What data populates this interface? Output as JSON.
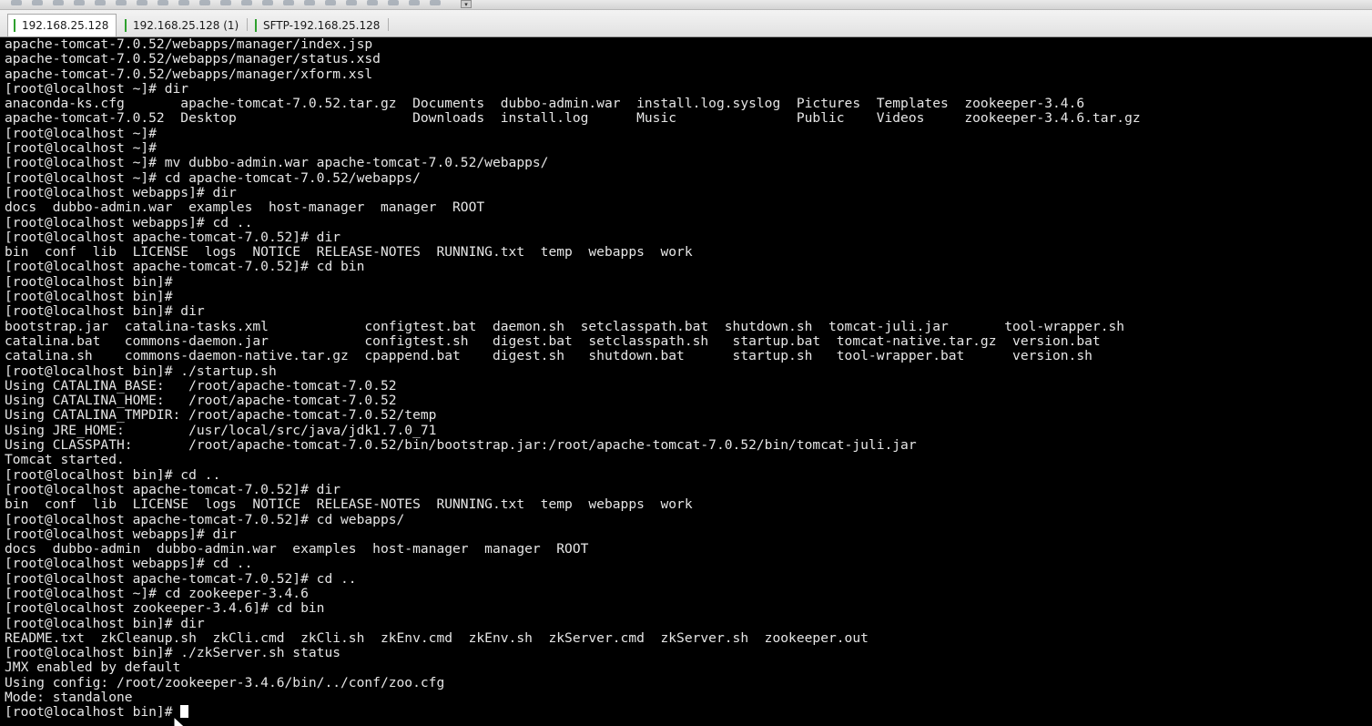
{
  "toolbar": {
    "icons": [
      "toolbar-icon",
      "toolbar-icon",
      "toolbar-icon",
      "toolbar-icon",
      "toolbar-icon",
      "toolbar-icon",
      "toolbar-icon",
      "toolbar-icon",
      "toolbar-icon",
      "toolbar-icon",
      "toolbar-icon",
      "toolbar-icon",
      "toolbar-icon",
      "toolbar-icon",
      "toolbar-icon",
      "toolbar-icon",
      "toolbar-icon",
      "toolbar-icon",
      "toolbar-icon",
      "toolbar-icon",
      "toolbar-icon"
    ],
    "dropdown_glyph": "▾"
  },
  "tabs": [
    {
      "label": "192.168.25.128",
      "active": true
    },
    {
      "label": "192.168.25.128 (1)",
      "active": false
    },
    {
      "label": "SFTP-192.168.25.128",
      "active": false
    }
  ],
  "terminal": {
    "lines": [
      "apache-tomcat-7.0.52/webapps/manager/index.jsp",
      "apache-tomcat-7.0.52/webapps/manager/status.xsd",
      "apache-tomcat-7.0.52/webapps/manager/xform.xsl",
      "[root@localhost ~]# dir",
      "anaconda-ks.cfg       apache-tomcat-7.0.52.tar.gz  Documents  dubbo-admin.war  install.log.syslog  Pictures  Templates  zookeeper-3.4.6",
      "apache-tomcat-7.0.52  Desktop                      Downloads  install.log      Music               Public    Videos     zookeeper-3.4.6.tar.gz",
      "[root@localhost ~]#",
      "[root@localhost ~]#",
      "[root@localhost ~]# mv dubbo-admin.war apache-tomcat-7.0.52/webapps/",
      "[root@localhost ~]# cd apache-tomcat-7.0.52/webapps/",
      "[root@localhost webapps]# dir",
      "docs  dubbo-admin.war  examples  host-manager  manager  ROOT",
      "[root@localhost webapps]# cd ..",
      "[root@localhost apache-tomcat-7.0.52]# dir",
      "bin  conf  lib  LICENSE  logs  NOTICE  RELEASE-NOTES  RUNNING.txt  temp  webapps  work",
      "[root@localhost apache-tomcat-7.0.52]# cd bin",
      "[root@localhost bin]#",
      "[root@localhost bin]#",
      "[root@localhost bin]# dir",
      "bootstrap.jar  catalina-tasks.xml            configtest.bat  daemon.sh  setclasspath.bat  shutdown.sh  tomcat-juli.jar       tool-wrapper.sh",
      "catalina.bat   commons-daemon.jar            configtest.sh   digest.bat  setclasspath.sh   startup.bat  tomcat-native.tar.gz  version.bat",
      "catalina.sh    commons-daemon-native.tar.gz  cpappend.bat    digest.sh   shutdown.bat      startup.sh   tool-wrapper.bat      version.sh",
      "[root@localhost bin]# ./startup.sh",
      "Using CATALINA_BASE:   /root/apache-tomcat-7.0.52",
      "Using CATALINA_HOME:   /root/apache-tomcat-7.0.52",
      "Using CATALINA_TMPDIR: /root/apache-tomcat-7.0.52/temp",
      "Using JRE_HOME:        /usr/local/src/java/jdk1.7.0_71",
      "Using CLASSPATH:       /root/apache-tomcat-7.0.52/bin/bootstrap.jar:/root/apache-tomcat-7.0.52/bin/tomcat-juli.jar",
      "Tomcat started.",
      "[root@localhost bin]# cd ..",
      "[root@localhost apache-tomcat-7.0.52]# dir",
      "bin  conf  lib  LICENSE  logs  NOTICE  RELEASE-NOTES  RUNNING.txt  temp  webapps  work",
      "[root@localhost apache-tomcat-7.0.52]# cd webapps/",
      "[root@localhost webapps]# dir",
      "docs  dubbo-admin  dubbo-admin.war  examples  host-manager  manager  ROOT",
      "[root@localhost webapps]# cd ..",
      "[root@localhost apache-tomcat-7.0.52]# cd ..",
      "[root@localhost ~]# cd zookeeper-3.4.6",
      "[root@localhost zookeeper-3.4.6]# cd bin",
      "[root@localhost bin]# dir",
      "README.txt  zkCleanup.sh  zkCli.cmd  zkCli.sh  zkEnv.cmd  zkEnv.sh  zkServer.cmd  zkServer.sh  zookeeper.out",
      "[root@localhost bin]# ./zkServer.sh status",
      "JMX enabled by default",
      "Using config: /root/zookeeper-3.4.6/bin/../conf/zoo.cfg",
      "Mode: standalone"
    ],
    "prompt": "[root@localhost bin]# "
  },
  "colors": {
    "terminal_bg": "#000000",
    "terminal_fg": "#e6e6e6",
    "tab_active_bg": "#ffffff",
    "tab_marker": "#2ea02e"
  }
}
